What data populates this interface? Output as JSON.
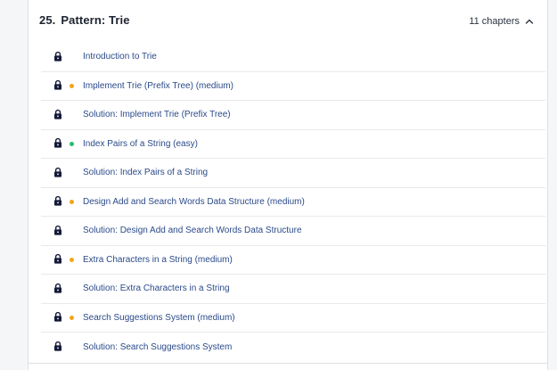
{
  "section": {
    "number": "25.",
    "title": "Pattern: Trie",
    "chapters_count": "11 chapters"
  },
  "colors": {
    "medium": "#f2a516",
    "easy": "#26c06a"
  },
  "items": [
    {
      "label": "Introduction to Trie",
      "difficulty": null
    },
    {
      "label": "Implement Trie (Prefix Tree) (medium)",
      "difficulty": "medium"
    },
    {
      "label": "Solution: Implement Trie (Prefix Tree)",
      "difficulty": null
    },
    {
      "label": "Index Pairs of a String (easy)",
      "difficulty": "easy"
    },
    {
      "label": "Solution: Index Pairs of a String",
      "difficulty": null
    },
    {
      "label": "Design Add and Search Words Data Structure (medium)",
      "difficulty": "medium"
    },
    {
      "label": "Solution: Design Add and Search Words Data Structure",
      "difficulty": null
    },
    {
      "label": "Extra Characters in a String (medium)",
      "difficulty": "medium"
    },
    {
      "label": "Solution: Extra Characters in a String",
      "difficulty": null
    },
    {
      "label": "Search Suggestions System (medium)",
      "difficulty": "medium"
    },
    {
      "label": "Solution: Search Suggestions System",
      "difficulty": null
    }
  ],
  "icons": {
    "lock": "lock-icon",
    "collapse": "chevron-up-icon"
  }
}
